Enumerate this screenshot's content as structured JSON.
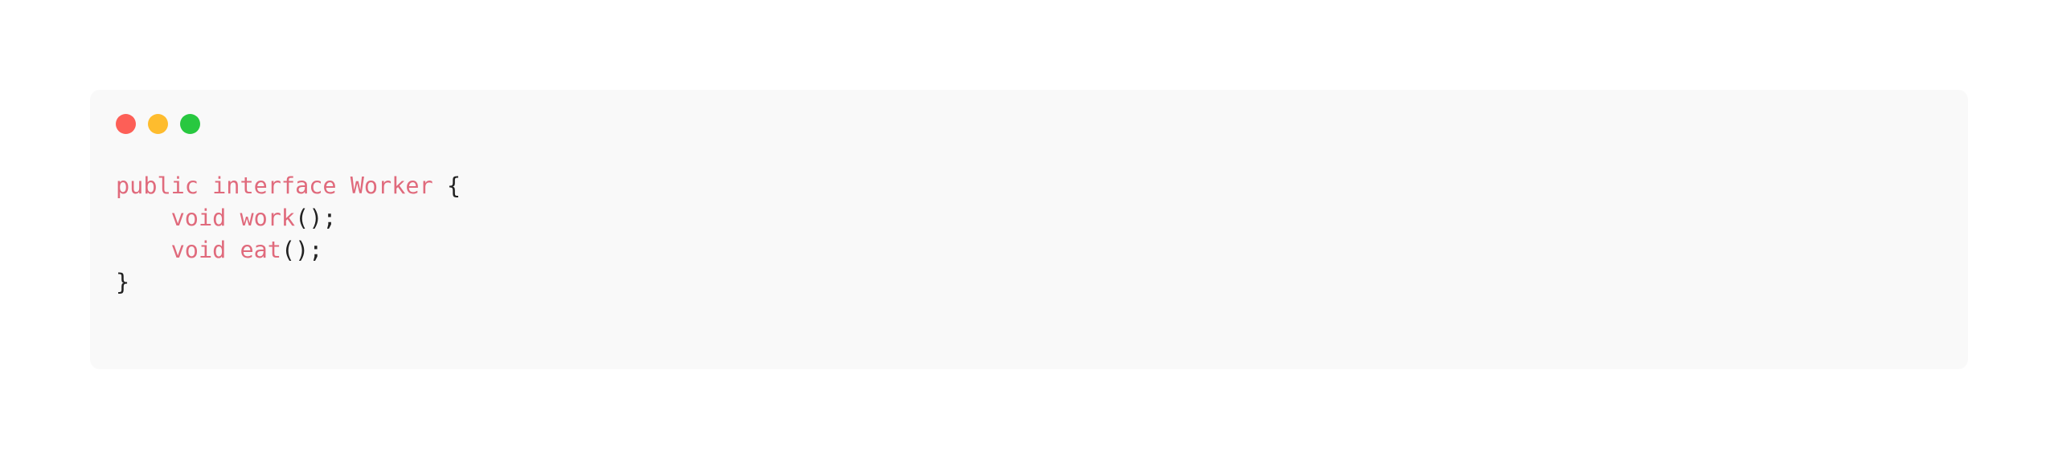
{
  "window": {
    "controls": [
      {
        "name": "close",
        "color": "#fd5f57"
      },
      {
        "name": "minimize",
        "color": "#febc2e"
      },
      {
        "name": "maximize",
        "color": "#28c840"
      }
    ]
  },
  "code": {
    "language": "java",
    "lines": [
      {
        "indent": "",
        "kw1": "public",
        "kw2": "interface",
        "name": "Worker",
        "tail": "{"
      },
      {
        "indent": "    ",
        "kw1": "void",
        "name": "work",
        "tail": "();"
      },
      {
        "indent": "    ",
        "kw1": "void",
        "name": "eat",
        "tail": "();"
      },
      {
        "indent": "",
        "tail": "}"
      }
    ]
  }
}
